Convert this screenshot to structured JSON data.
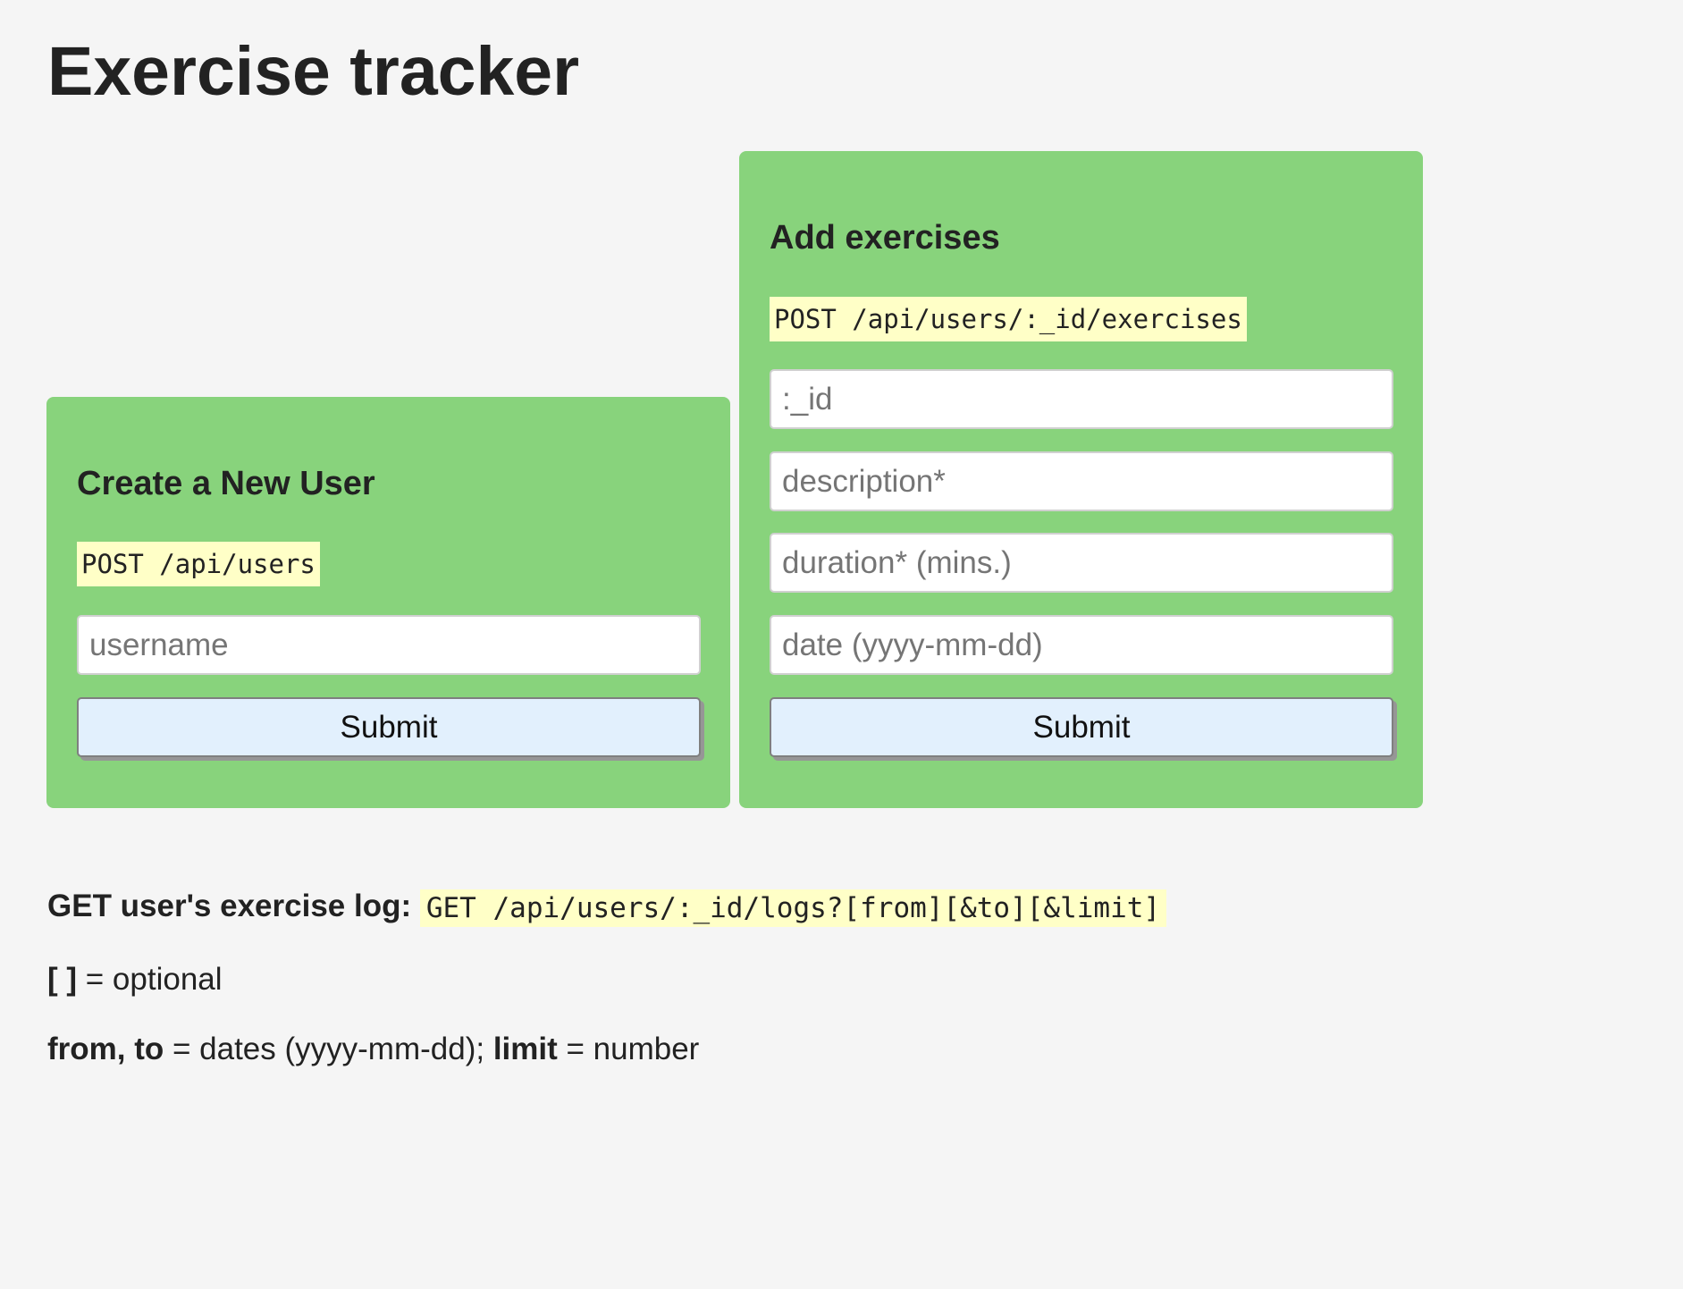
{
  "page": {
    "title": "Exercise tracker"
  },
  "create_user": {
    "heading": "Create a New User",
    "endpoint": "POST /api/users",
    "username_placeholder": "username",
    "submit_label": "Submit"
  },
  "add_exercises": {
    "heading": "Add exercises",
    "endpoint": "POST /api/users/:_id/exercises",
    "id_placeholder": ":_id",
    "description_placeholder": "description*",
    "duration_placeholder": "duration* (mins.)",
    "date_placeholder": "date (yyyy-mm-dd)",
    "submit_label": "Submit"
  },
  "log_info": {
    "label": "GET user's exercise log:",
    "endpoint": "GET /api/users/:_id/logs?[from][&to][&limit]",
    "optional_key": "[ ]",
    "optional_text": " = optional",
    "params_key_1": "from, to",
    "params_text_1": " = dates (yyyy-mm-dd); ",
    "params_key_2": "limit",
    "params_text_2": " = number"
  },
  "colors": {
    "background": "#f5f5f5",
    "panel": "#88d37c",
    "code_highlight": "#ffffc7",
    "button": "#e2f0fd"
  }
}
